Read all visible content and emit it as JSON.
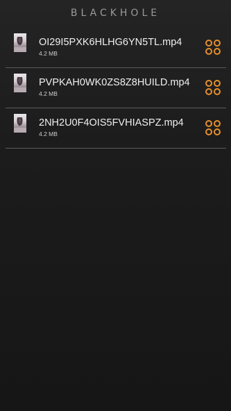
{
  "app": {
    "title": "BLACKHOLE"
  },
  "files": [
    {
      "name": "OI29I5PXK6HLHG6YN5TL.mp4",
      "size": "4.2 MB"
    },
    {
      "name": "PVPKAH0WK0ZS8Z8HUILD.mp4",
      "size": "4.2 MB"
    },
    {
      "name": "2NH2U0F4OIS5FVHIASPZ.mp4",
      "size": "4.2 MB"
    }
  ],
  "colors": {
    "accent": "#e8902c",
    "background": "#1c1c1c",
    "divider": "#5a5a5a"
  },
  "icons": {
    "thumbnail": "video-thumbnail",
    "menu": "four-circles-menu-icon"
  }
}
